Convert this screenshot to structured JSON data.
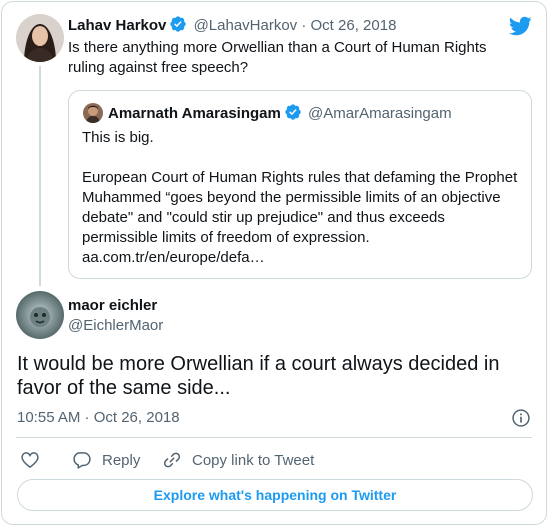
{
  "parent_tweet": {
    "author_name": "Lahav Harkov",
    "handle": "@LahavHarkov",
    "separator": "·",
    "date": "Oct 26, 2018",
    "text": "Is there anything more Orwellian than a Court of Human Rights ruling against free speech?"
  },
  "quoted_tweet": {
    "author_name": "Amarnath Amarasingam",
    "handle": "@AmarAmarasingam",
    "line1": "This is big.",
    "line2": "European Court of Human Rights rules that defaming the Prophet Muhammed “goes beyond the permissible limits of an objective debate\" and \"could stir up prejudice\" and thus exceeds permissible limits of freedom of expression.",
    "link": "aa.com.tr/en/europe/defa…"
  },
  "reply_tweet": {
    "author_name": "maor eichler",
    "handle": "@EichlerMaor",
    "text": "It would be more Orwellian if a court always decided in favor of the same side...",
    "timestamp": "10:55 AM · Oct 26, 2018"
  },
  "actions": {
    "reply_label": "Reply",
    "copy_label": "Copy link to Tweet"
  },
  "explore_label": "Explore what's happening on Twitter",
  "icons": {
    "verified": "verified-badge-icon",
    "bird": "twitter-bird-icon",
    "info": "info-icon",
    "heart": "heart-icon",
    "reply": "reply-bubble-icon",
    "copy": "link-icon"
  },
  "colors": {
    "brand": "#1d9bf0",
    "text": "#0f1419",
    "secondary": "#536471",
    "border": "#cfd9de"
  }
}
